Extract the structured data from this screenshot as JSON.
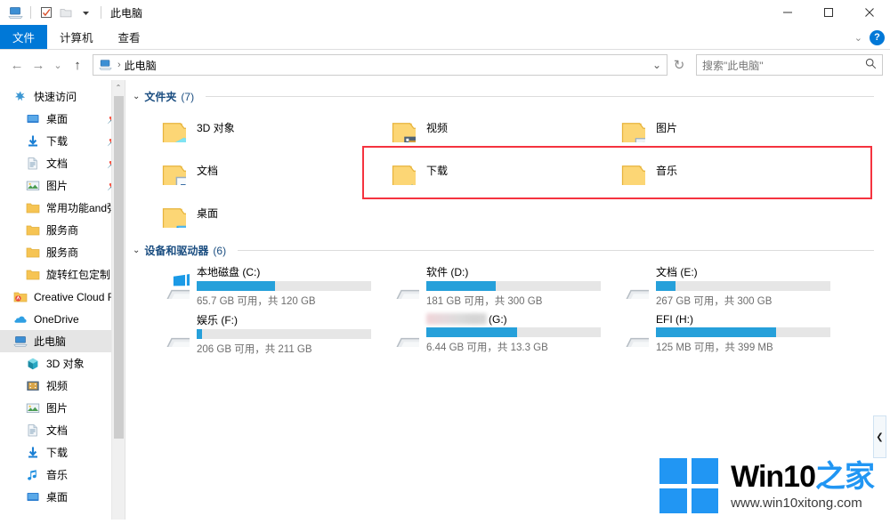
{
  "window": {
    "title": "此电脑",
    "quick_access_icons": [
      "computer-icon",
      "checkbox-icon",
      "folder-icon",
      "chevron-down-icon"
    ],
    "controls": {
      "minimize": "—",
      "maximize": "☐",
      "close": "✕"
    }
  },
  "ribbon": {
    "tabs": [
      {
        "label": "文件",
        "active": true
      },
      {
        "label": "计算机",
        "active": false
      },
      {
        "label": "查看",
        "active": false
      }
    ],
    "collapse_label": "⌄",
    "help_label": "?"
  },
  "address": {
    "back": "←",
    "forward": "→",
    "recent": "⌄",
    "up": "↑",
    "breadcrumb_icon": "computer-icon",
    "breadcrumb_sep": "›",
    "breadcrumb": "此电脑",
    "dropdown": "⌄",
    "refresh": "↻"
  },
  "search": {
    "placeholder": "搜索\"此电脑\"",
    "icon": "search-icon"
  },
  "sidebar": {
    "items": [
      {
        "label": "快速访问",
        "icon": "star-icon",
        "level": 0,
        "pinned": false,
        "selected": false
      },
      {
        "label": "桌面",
        "icon": "desktop-icon",
        "level": 1,
        "pinned": true,
        "selected": false
      },
      {
        "label": "下载",
        "icon": "download-icon",
        "level": 1,
        "pinned": true,
        "selected": false
      },
      {
        "label": "文档",
        "icon": "document-icon",
        "level": 1,
        "pinned": true,
        "selected": false
      },
      {
        "label": "图片",
        "icon": "pictures-icon",
        "level": 1,
        "pinned": true,
        "selected": false
      },
      {
        "label": "常用功能and弹窗",
        "icon": "folder-icon",
        "level": 1,
        "pinned": false,
        "selected": false
      },
      {
        "label": "服务商",
        "icon": "folder-icon",
        "level": 1,
        "pinned": false,
        "selected": false
      },
      {
        "label": "服务商",
        "icon": "folder-icon",
        "level": 1,
        "pinned": false,
        "selected": false
      },
      {
        "label": "旋转红包定制",
        "icon": "folder-icon",
        "level": 1,
        "pinned": false,
        "selected": false
      },
      {
        "label": "Creative Cloud Files",
        "icon": "creative-cloud-icon",
        "level": 0,
        "pinned": false,
        "selected": false
      },
      {
        "label": "OneDrive",
        "icon": "onedrive-icon",
        "level": 0,
        "pinned": false,
        "selected": false
      },
      {
        "label": "此电脑",
        "icon": "computer-icon",
        "level": 0,
        "pinned": false,
        "selected": true
      },
      {
        "label": "3D 对象",
        "icon": "3d-objects-icon",
        "level": 1,
        "pinned": false,
        "selected": false
      },
      {
        "label": "视频",
        "icon": "videos-icon",
        "level": 1,
        "pinned": false,
        "selected": false
      },
      {
        "label": "图片",
        "icon": "pictures-icon",
        "level": 1,
        "pinned": false,
        "selected": false
      },
      {
        "label": "文档",
        "icon": "document-icon",
        "level": 1,
        "pinned": false,
        "selected": false
      },
      {
        "label": "下载",
        "icon": "download-icon",
        "level": 1,
        "pinned": false,
        "selected": false
      },
      {
        "label": "音乐",
        "icon": "music-icon",
        "level": 1,
        "pinned": false,
        "selected": false
      },
      {
        "label": "桌面",
        "icon": "desktop-icon",
        "level": 1,
        "pinned": false,
        "selected": false
      }
    ],
    "scroll_up_arrow": "⌃"
  },
  "folders_group": {
    "chevron": "⌄",
    "title": "文件夹",
    "count": "(7)",
    "items": [
      {
        "label": "3D 对象",
        "icon": "folder-3d-objects-icon"
      },
      {
        "label": "视频",
        "icon": "folder-videos-icon"
      },
      {
        "label": "图片",
        "icon": "folder-pictures-icon"
      },
      {
        "label": "文档",
        "icon": "folder-documents-icon"
      },
      {
        "label": "下载",
        "icon": "folder-downloads-icon"
      },
      {
        "label": "音乐",
        "icon": "folder-music-icon"
      },
      {
        "label": "桌面",
        "icon": "folder-desktop-icon"
      }
    ]
  },
  "drives_group": {
    "chevron": "⌄",
    "title": "设备和驱动器",
    "count": "(6)",
    "items": [
      {
        "name": "本地磁盘 (C:)",
        "capacity": "65.7 GB 可用，共 120 GB",
        "used_percent": 45,
        "icon": "windows-drive-icon",
        "blurred": false,
        "highlighted": false
      },
      {
        "name": "软件 (D:)",
        "capacity": "181 GB 可用，共 300 GB",
        "used_percent": 40,
        "icon": "drive-icon",
        "blurred": false,
        "highlighted": false
      },
      {
        "name": "文档 (E:)",
        "capacity": "267 GB 可用，共 300 GB",
        "used_percent": 11,
        "icon": "drive-icon",
        "blurred": false,
        "highlighted": false
      },
      {
        "name": "娱乐 (F:)",
        "capacity": "206 GB 可用，共 211 GB",
        "used_percent": 3,
        "icon": "drive-icon",
        "blurred": false,
        "highlighted": false
      },
      {
        "name": "(G:)",
        "capacity": "6.44 GB 可用，共 13.3 GB",
        "used_percent": 52,
        "icon": "drive-icon",
        "blurred": true,
        "highlighted": true
      },
      {
        "name": "EFI (H:)",
        "capacity": "125 MB 可用，共 399 MB",
        "used_percent": 69,
        "icon": "drive-icon",
        "blurred": false,
        "highlighted": true
      }
    ],
    "highlight_color": "#f5333f"
  },
  "side_panel": {
    "toggle": "❮"
  },
  "watermark": {
    "title_black": "Win10",
    "title_blue": "之家",
    "url": "www.win10xitong.com"
  },
  "colors": {
    "accent": "#0078d7",
    "bar": "#26a0da",
    "highlight": "#f5333f",
    "selection": "#e5e5e5"
  }
}
